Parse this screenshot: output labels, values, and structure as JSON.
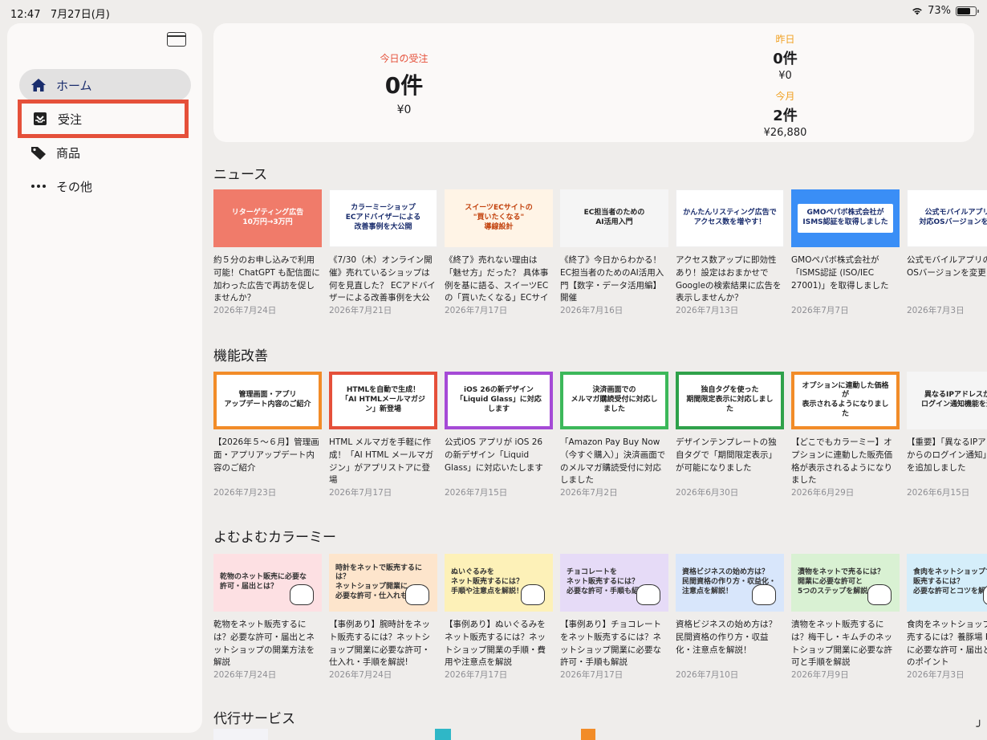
{
  "status_bar": {
    "time": "12:47",
    "date": "7月27日(月)",
    "battery": "73%",
    "battery_level": 0.73
  },
  "sidebar": {
    "items": [
      {
        "label": "ホーム",
        "icon": "home-icon"
      },
      {
        "label": "受注",
        "icon": "inbox-icon"
      },
      {
        "label": "商品",
        "icon": "tag-icon"
      },
      {
        "label": "その他",
        "icon": "more-icon"
      }
    ]
  },
  "summary": {
    "today": {
      "label": "今日の受注",
      "count": "0件",
      "amount": "¥0"
    },
    "yesterday": {
      "label": "昨日",
      "count": "0件",
      "amount": "¥0"
    },
    "month": {
      "label": "今月",
      "count": "2件",
      "amount": "¥26,880"
    }
  },
  "sections": {
    "news": {
      "title": "ニュース",
      "cards": [
        {
          "thumb": "リターゲティング広告\n10万円→3万円",
          "title": "約５分のお申し込みで利用可能！ChatGPT も配信面に加わった広告で再訪を促しませんか？",
          "date": "2026年7月24日"
        },
        {
          "thumb": "カラーミーショップ\nECアドバイザーによる\n改善事例を大公開",
          "title": "《7/30（木）オンライン開催》売れているショップは何を見直した？ ECアドバイザーによる改善事例を大公開",
          "date": "2026年7月21日"
        },
        {
          "thumb": "スイーツECサイトの\n\"買いたくなる\"\n導線設計",
          "title": "《終了》売れない理由は「魅せ方」だった？ 具体事例を基に語る、スイーツECの「買いたくなる」ECサイトの導線…",
          "date": "2026年7月17日"
        },
        {
          "thumb": "EC担当者のための\nAI活用入門",
          "title": "《終了》今日からわかる！EC担当者のためのAI活用入門【数字・データ活用編】開催",
          "date": "2026年7月16日"
        },
        {
          "thumb": "かんたんリスティング広告で\nアクセス数を増やす！",
          "title": "アクセス数アップに即効性あり！設定はおまかせでGoogleの検索結果に広告を表示しませんか？",
          "date": "2026年7月13日"
        },
        {
          "thumb": "GMOペパボ株式会社が\nISMS認証を取得しました",
          "title": "GMOペパボ株式会社が「ISMS認証 (ISO/IEC 27001)」を取得しました",
          "date": "2026年7月7日"
        },
        {
          "thumb": "公式モバイルアプリの\n対応OSバージョンを変更",
          "title": "公式モバイルアプリの対応OSバージョンを変更",
          "date": "2026年7月3日"
        }
      ]
    },
    "improvements": {
      "title": "機能改善",
      "cards": [
        {
          "thumb": "管理画面・アプリ\nアップデート内容のご紹介",
          "title": "【2026年５〜６月】管理画面・アプリアップデート内容のご紹介",
          "date": "2026年7月23日"
        },
        {
          "thumb": "HTMLを自動で生成！\n「AI HTMLメールマガジン」新登場",
          "title": "HTML メルマガを手軽に作成！「AI HTML メールマガジン」がアプリストアに登場",
          "date": "2026年7月17日"
        },
        {
          "thumb": "iOS 26の新デザイン\n「Liquid Glass」に対応します",
          "title": "公式iOS アプリが iOS 26 の新デザイン「Liquid Glass」に対応いたします",
          "date": "2026年7月15日"
        },
        {
          "thumb": "決済画面での\nメルマガ購読受付に対応しました",
          "title": "「Amazon Pay Buy Now（今すぐ購入）」決済画面でのメルマガ購読受付に対応しました",
          "date": "2026年7月2日"
        },
        {
          "thumb": "独自タグを使った\n期間限定表示に対応しました",
          "title": "デザインテンプレートの独自タグで「期間限定表示」が可能になりました",
          "date": "2026年6月30日"
        },
        {
          "thumb": "オプションに連動した価格が\n表示されるようになりました",
          "title": "【どこでもカラーミー】オプションに連動した販売価格が表示されるようになりました",
          "date": "2026年6月29日"
        },
        {
          "thumb": "異なるIPアドレスから\nログイン通知機能を追加",
          "title": "【重要】「異なるIPアドレスからのログイン通知」機能を追加しました",
          "date": "2026年6月15日"
        }
      ]
    },
    "yomuyomu": {
      "title": "よむよむカラーミー",
      "cards": [
        {
          "thumb": "乾物のネット販売に必要な\n許可・届出とは？",
          "title": "乾物をネット販売するには？必要な許可・届出とネットショップの開業方法を解説",
          "date": "2026年7月24日"
        },
        {
          "thumb": "時計をネットで販売するには？\nネットショップ開業に\n必要な許可・仕入れも紹介",
          "title": "【事例あり】腕時計をネット販売するには？ネットショップ開業に必要な許可・仕入れ・手順を解説!",
          "date": "2026年7月24日"
        },
        {
          "thumb": "ぬいぐるみを\nネット販売するには？\n手順や注意点を解説！",
          "title": "【事例あり】ぬいぐるみをネット販売するには？ネットショップ開業の手順・費用や注意点を解説",
          "date": "2026年7月17日"
        },
        {
          "thumb": "チョコレートを\nネット販売するには？\n必要な許可・手順も紹介！",
          "title": "【事例あり】チョコレートをネット販売するには？ネットショップ開業に必要な許可・手順も解説",
          "date": "2026年7月17日"
        },
        {
          "thumb": "資格ビジネスの始め方は？\n民間資格の作り方・収益化・\n注意点を解説！",
          "title": "資格ビジネスの始め方は？民間資格の作り方・収益化・注意点を解説！",
          "date": "2026年7月10日"
        },
        {
          "thumb": "漬物をネットで売るには？\n開業に必要な許可と\n5つのステップを解説！",
          "title": "漬物をネット販売するには？梅干し・キムチのネットショップ開業に必要な許可と手順を解説",
          "date": "2026年7月9日"
        },
        {
          "thumb": "食肉をネットショップで\n販売するには？\n必要な許可とコツを解説！",
          "title": "食肉をネットショップで販売するには？養豚場 EC開業に必要な許可・届出と成功のポイント",
          "date": "2026年7月3日"
        }
      ]
    },
    "agency": {
      "title": "代行サービス"
    }
  }
}
